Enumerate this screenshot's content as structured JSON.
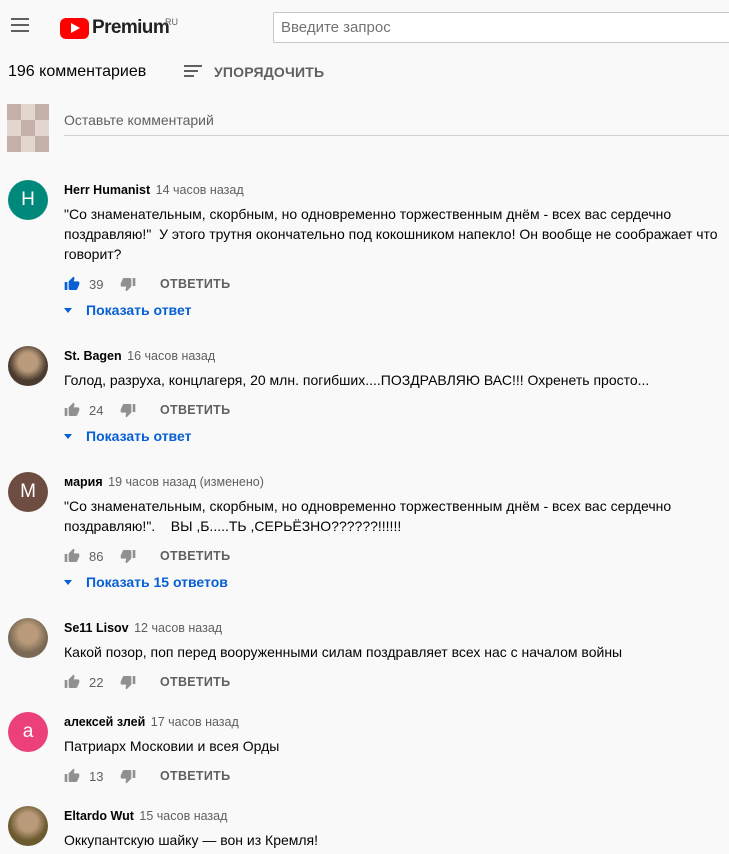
{
  "header": {
    "logo_text": "Premium",
    "logo_region": "RU",
    "search_placeholder": "Введите запрос"
  },
  "comments_header": {
    "count_label": "196 комментариев",
    "sort_label": "УПОРЯДОЧИТЬ"
  },
  "add_comment": {
    "placeholder": "Оставьте комментарий"
  },
  "reply_label": "ОТВЕТИТЬ",
  "comments": [
    {
      "author": "Herr Humanist",
      "time": "14 часов назад",
      "avatar_letter": "H",
      "avatar_color": "#00897b",
      "text": "\"Со знаменательным, скорбным, но одновременно торжественным днём - всех вас сердечно\nпоздравляю!\"  У этого трутня окончательно под кокошником напекло! Он вообще не соображает что\nговорит?",
      "likes": "39",
      "liked": true,
      "replies_label": "Показать ответ"
    },
    {
      "author": "St. Bagen",
      "time": "16 часов назад",
      "avatar_letter": "",
      "avatar_color": "#4a3a30",
      "text": "Голод, разруха, концлагеря, 20 млн. погибших....ПОЗДРАВЛЯЮ ВАС!!! Охренеть просто...",
      "likes": "24",
      "liked": false,
      "replies_label": "Показать ответ"
    },
    {
      "author": "мария",
      "time": "19 часов назад (изменено)",
      "avatar_letter": "М",
      "avatar_color": "#6d4c41",
      "text": "\"Со знаменательным, скорбным, но одновременно торжественным днём - всех вас сердечно\nпоздравляю!\".    ВЫ ,Б.....ТЬ ,СЕРЬЁЗНО??????!!!!!!",
      "likes": "86",
      "liked": false,
      "replies_label": "Показать 15 ответов"
    },
    {
      "author": "Se11 Lisov",
      "time": "12 часов назад",
      "avatar_letter": "",
      "avatar_color": "#7a6a55",
      "text": "Какой позор, поп перед вооруженными силам поздравляет всех нас с началом войны",
      "likes": "22",
      "liked": false,
      "replies_label": ""
    },
    {
      "author": "алексей злей",
      "time": "17 часов назад",
      "avatar_letter": "а",
      "avatar_color": "#ec407a",
      "text": "Патриарх Московии и всея Орды",
      "likes": "13",
      "liked": false,
      "replies_label": ""
    },
    {
      "author": "Eltardo Wut",
      "time": "15 часов назад",
      "avatar_letter": "",
      "avatar_color": "#6b5a2e",
      "text": "Оккупантскую шайку — вон из Кремля!",
      "likes": "",
      "liked": false,
      "replies_label": ""
    }
  ]
}
